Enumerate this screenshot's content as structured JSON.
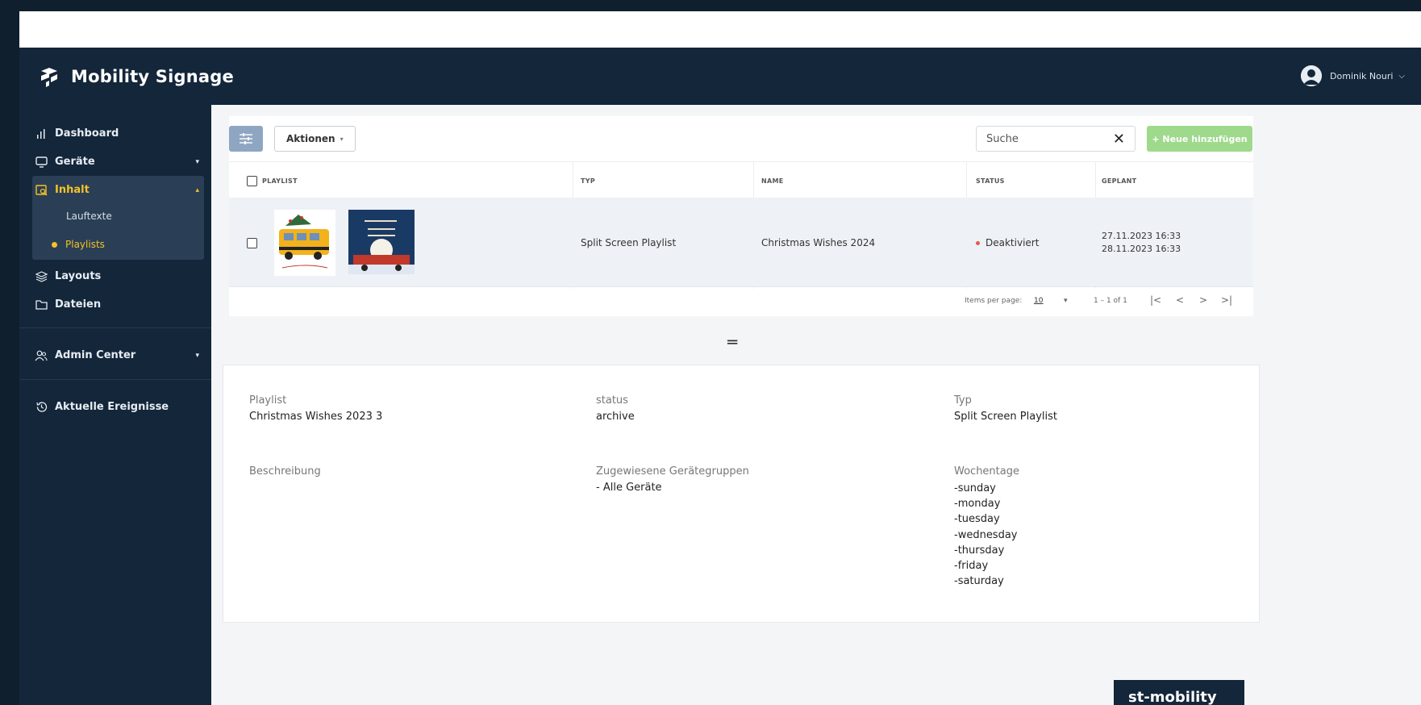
{
  "app": {
    "title": "Mobility Signage"
  },
  "user": {
    "name": "Dominik Nouri"
  },
  "sidebar": {
    "items": [
      {
        "label": "Dashboard"
      },
      {
        "label": "Geräte"
      },
      {
        "label": "Inhalt"
      },
      {
        "label": "Layouts"
      },
      {
        "label": "Dateien"
      },
      {
        "label": "Admin Center"
      },
      {
        "label": "Aktuelle Ereignisse"
      }
    ],
    "subitems": [
      {
        "label": "Lauftexte"
      },
      {
        "label": "Playlists"
      }
    ]
  },
  "toolbar": {
    "actions_label": "Aktionen",
    "search_value": "Suche",
    "add_label": "+ Neue hinzufügen"
  },
  "table": {
    "headers": [
      "PLAYLIST",
      "TYP",
      "NAME",
      "STATUS",
      "GEPLANT"
    ],
    "rows": [
      {
        "typ": "Split Screen Playlist",
        "name": "Christmas Wishes 2024",
        "status": "Deaktiviert",
        "geplant_start": "27.11.2023 16:33",
        "geplant_end": "28.11.2023 16:33"
      }
    ]
  },
  "pagination": {
    "items_per_page_label": "Items per page:",
    "items_per_page_value": "10",
    "range": "1 – 1 of 1"
  },
  "detail": {
    "playlist_label": "Playlist",
    "playlist_value": "Christmas Wishes 2023 3",
    "status_label": "status",
    "status_value": "archive",
    "typ_label": "Typ",
    "typ_value": "Split Screen Playlist",
    "beschreibung_label": "Beschreibung",
    "gruppen_label": "Zugewiesene Gerätegruppen",
    "gruppen_value": "- Alle Geräte",
    "wochentage_label": "Wochentage",
    "wochentage": [
      "-sunday",
      "-monday",
      "-tuesday",
      "-wednesday",
      "-thursday",
      "-friday",
      "-saturday"
    ]
  },
  "watermark": {
    "text": "st-mobility"
  },
  "colors": {
    "navy": "#13263a",
    "accent": "#f3c228",
    "add_button": "#9ed98c",
    "status_red": "#e35b4c"
  }
}
